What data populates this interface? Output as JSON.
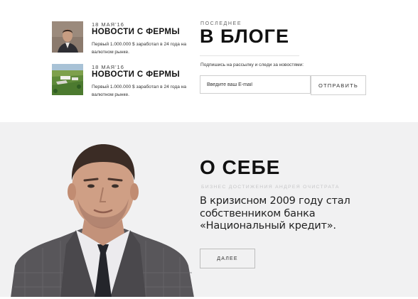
{
  "news": [
    {
      "date": "18 МАЯ'16",
      "title": "НОВОСТИ С ФЕРМЫ",
      "text": "Первый 1.000.000 $ заработал в 24 года на валютном рынке.",
      "thumb": "man-portrait-photo"
    },
    {
      "date": "18 МАЯ'16",
      "title": "НОВОСТИ С ФЕРМЫ",
      "text": "Первый 1.000.000 $ заработал в 24 года на валютном рынке.",
      "thumb": "farm-aerial-photo"
    }
  ],
  "blog": {
    "kicker": "ПОСЛЕДНЕЕ",
    "title": "В БЛОГЕ",
    "subscribe_text": "Подпишись на рассылку и следи за новостями:",
    "email_placeholder": "Введите ваш E-mail",
    "send_label": "ОТПРАВИТЬ"
  },
  "about": {
    "title": "О СЕБЕ",
    "subtitle": "БИЗНЕС ДОСТИЖЕНИЯ АНДРЕЯ ОЧИСТРАТА",
    "text": "В кризисном 2009 году стал собственником банка «Национальный кредит».",
    "more_label": "ДАЛЕЕ",
    "bg_color": "#f1f1f2"
  }
}
